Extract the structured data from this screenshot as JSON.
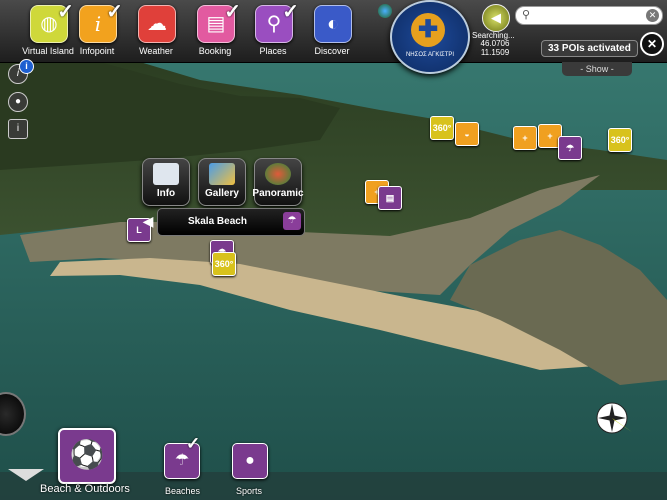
{
  "nav": [
    {
      "label": "Virtual Island",
      "icon": "island-icon",
      "color": "#cfd83a",
      "checked": true
    },
    {
      "label": "Infopoint",
      "icon": "info-icon",
      "color": "#f2a21e",
      "checked": true
    },
    {
      "label": "Weather",
      "icon": "weather-icon",
      "color": "#e0403a",
      "checked": false
    },
    {
      "label": "Booking",
      "icon": "booking-icon",
      "color": "#e25aa0",
      "checked": true
    },
    {
      "label": "Places",
      "icon": "pin-icon",
      "color": "#9a4ec0",
      "checked": true
    },
    {
      "label": "Discover",
      "icon": "discover-icon",
      "color": "#3a5ac8",
      "checked": false
    }
  ],
  "logo": {
    "caption": "ΝΗΣΟΣ ΑΓΚΙΣΤΡΙ"
  },
  "gps": {
    "status": "Searching...",
    "lat": "46.0706",
    "lon": "11.1509"
  },
  "search": {
    "value": "",
    "placeholder": ""
  },
  "poi_count": "33 POIs activated",
  "show_tab": "- Show -",
  "popup": {
    "title": "Skala Beach",
    "buttons": [
      {
        "label": "Info"
      },
      {
        "label": "Gallery"
      },
      {
        "label": "Panoramic"
      }
    ]
  },
  "markers": {
    "panoramic_label": "360°",
    "info_label": "+"
  },
  "category": {
    "label": "Beach & Outdoors",
    "color": "#7a3a8e"
  },
  "subcategories": [
    {
      "label": "Beaches",
      "checked": true
    },
    {
      "label": "Sports",
      "checked": false
    }
  ],
  "colors": {
    "topbar": "#2a2a2a",
    "sea": "#2f6f67",
    "land": "#b8a88a",
    "marker_yellow": "#d8c21c",
    "marker_orange": "#f0a020",
    "marker_purple": "#7a3a8e"
  }
}
